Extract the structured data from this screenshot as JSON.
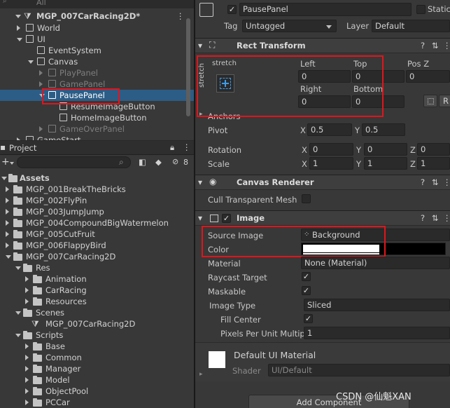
{
  "hierarchy": {
    "search_placeholder": "All",
    "scene": "MGP_007CarRacing2D*",
    "items": [
      {
        "label": "World",
        "indent": 1,
        "expand": "right",
        "dim": false
      },
      {
        "label": "UI",
        "indent": 1,
        "expand": "down",
        "dim": false
      },
      {
        "label": "EventSystem",
        "indent": 2,
        "expand": "none",
        "dim": false
      },
      {
        "label": "Canvas",
        "indent": 2,
        "expand": "down",
        "dim": false
      },
      {
        "label": "PlayPanel",
        "indent": 3,
        "expand": "right",
        "dim": true
      },
      {
        "label": "GamePanel",
        "indent": 3,
        "expand": "right",
        "dim": true
      },
      {
        "label": "PausePanel",
        "indent": 3,
        "expand": "down",
        "dim": false,
        "selected": true
      },
      {
        "label": "ResumeImageButton",
        "indent": 4,
        "expand": "none",
        "dim": false
      },
      {
        "label": "HomeImageButton",
        "indent": 4,
        "expand": "none",
        "dim": false
      },
      {
        "label": "GameOverPanel",
        "indent": 3,
        "expand": "right",
        "dim": true
      },
      {
        "label": "GameStart",
        "indent": 1,
        "expand": "right",
        "dim": false
      }
    ]
  },
  "project": {
    "tab": "Project",
    "add_label": "+",
    "hidden_count": "8",
    "assets_label": "Assets",
    "items": [
      {
        "label": "MGP_001BreakTheBricks",
        "indent": 1,
        "expand": "right",
        "kind": "folder"
      },
      {
        "label": "MGP_002FlyPin",
        "indent": 1,
        "expand": "right",
        "kind": "folder"
      },
      {
        "label": "MGP_003JumpJump",
        "indent": 1,
        "expand": "right",
        "kind": "folder"
      },
      {
        "label": "MGP_004CompoundBigWatermelon",
        "indent": 1,
        "expand": "right",
        "kind": "folder"
      },
      {
        "label": "MGP_005CutFruit",
        "indent": 1,
        "expand": "right",
        "kind": "folder"
      },
      {
        "label": "MGP_006FlappyBird",
        "indent": 1,
        "expand": "right",
        "kind": "folder"
      },
      {
        "label": "MGP_007CarRacing2D",
        "indent": 1,
        "expand": "down",
        "kind": "folder"
      },
      {
        "label": "Res",
        "indent": 2,
        "expand": "down",
        "kind": "folder"
      },
      {
        "label": "Animation",
        "indent": 3,
        "expand": "right",
        "kind": "folder"
      },
      {
        "label": "CarRacing",
        "indent": 3,
        "expand": "right",
        "kind": "folder"
      },
      {
        "label": "Resources",
        "indent": 3,
        "expand": "right",
        "kind": "folder"
      },
      {
        "label": "Scenes",
        "indent": 2,
        "expand": "down",
        "kind": "folder"
      },
      {
        "label": "MGP_007CarRacing2D",
        "indent": 3,
        "expand": "none",
        "kind": "scene"
      },
      {
        "label": "Scripts",
        "indent": 2,
        "expand": "down",
        "kind": "folder"
      },
      {
        "label": "Base",
        "indent": 3,
        "expand": "right",
        "kind": "folder"
      },
      {
        "label": "Common",
        "indent": 3,
        "expand": "right",
        "kind": "folder"
      },
      {
        "label": "Manager",
        "indent": 3,
        "expand": "right",
        "kind": "folder"
      },
      {
        "label": "Model",
        "indent": 3,
        "expand": "right",
        "kind": "folder"
      },
      {
        "label": "ObjectPool",
        "indent": 3,
        "expand": "right",
        "kind": "folder"
      },
      {
        "label": "PCCar",
        "indent": 3,
        "expand": "right",
        "kind": "folder"
      }
    ]
  },
  "inspector": {
    "object_name": "PausePanel",
    "static_label": "Static",
    "tag_label": "Tag",
    "tag_value": "Untagged",
    "layer_label": "Layer",
    "layer_value": "Default",
    "rect_transform": {
      "title": "Rect Transform",
      "anchor_h": "stretch",
      "anchor_v": "stretch",
      "left_label": "Left",
      "left_value": "0",
      "top_label": "Top",
      "top_value": "0",
      "posz_label": "Pos Z",
      "posz_value": "0",
      "right_label": "Right",
      "right_value": "0",
      "bottom_label": "Bottom",
      "bottom_value": "0",
      "r_button": "R",
      "anchors_label": "Anchors",
      "pivot_label": "Pivot",
      "pivot_x": "0.5",
      "pivot_y": "0.5",
      "rotation_label": "Rotation",
      "rot_x": "0",
      "rot_y": "0",
      "rot_z": "0",
      "scale_label": "Scale",
      "scale_x": "1",
      "scale_y": "1",
      "scale_z": "1",
      "x_label": "X",
      "y_label": "Y",
      "z_label": "Z"
    },
    "canvas_renderer": {
      "title": "Canvas Renderer",
      "cull_label": "Cull Transparent Mesh"
    },
    "image": {
      "title": "Image",
      "source_image_label": "Source Image",
      "source_image_value": "Background",
      "color_label": "Color",
      "material_label": "Material",
      "material_value": "None (Material)",
      "raycast_label": "Raycast Target",
      "maskable_label": "Maskable",
      "image_type_label": "Image Type",
      "image_type_value": "Sliced",
      "fill_center_label": "Fill Center",
      "ppu_label": "Pixels Per Unit Multip",
      "ppu_value": "1"
    },
    "material_preview": {
      "name": "Default UI Material",
      "shader_label": "Shader",
      "shader_value": "UI/Default"
    },
    "add_component": "Add Component",
    "watermark": "CSDN @仙魁XAN"
  },
  "colors": {
    "selection": "#2c5d87",
    "highlight_box": "#e3141b",
    "panel_bg": "#383838",
    "field_bg": "#2a2a2a"
  }
}
